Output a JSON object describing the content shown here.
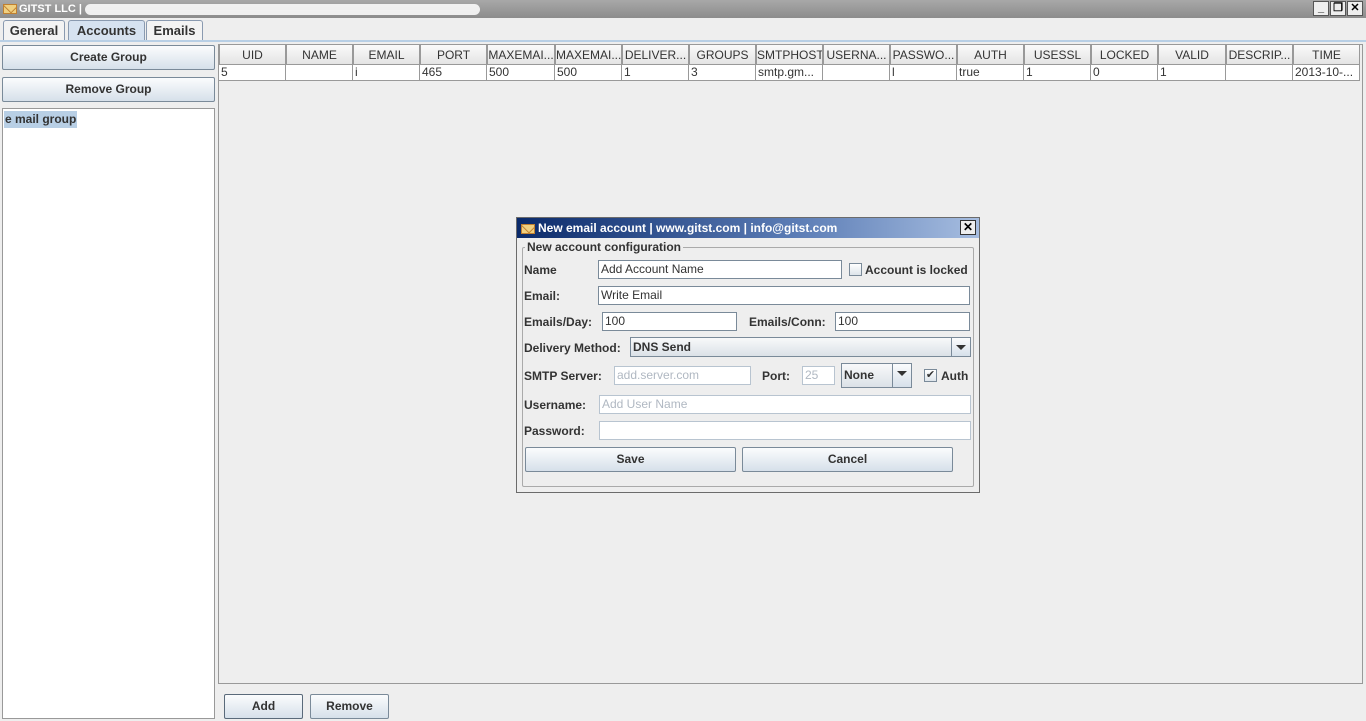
{
  "window": {
    "title": "GITST LLC |",
    "controls": [
      "minimize",
      "restore",
      "close"
    ]
  },
  "tabs": [
    {
      "label": "General"
    },
    {
      "label": "Accounts",
      "selected": true
    },
    {
      "label": "Emails"
    }
  ],
  "sidebar": {
    "create_group": "Create Group",
    "remove_group": "Remove Group",
    "groups": [
      "e mail group"
    ]
  },
  "table": {
    "columns": [
      "UID",
      "NAME",
      "EMAIL",
      "PORT",
      "MAXEMAI...",
      "MAXEMAI...",
      "DELIVER...",
      "GROUPS",
      "SMTPHOST",
      "USERNA...",
      "PASSWO...",
      "AUTH",
      "USESSL",
      "LOCKED",
      "VALID",
      "DESCRIP...",
      "TIME"
    ],
    "rows": [
      [
        "5",
        "",
        "i",
        "465",
        "500",
        "500",
        "1",
        "3",
        "smtp.gm...",
        "",
        "l",
        "true",
        "1",
        "0",
        "1",
        "",
        "2013-10-..."
      ]
    ]
  },
  "bottom": {
    "add": "Add",
    "remove": "Remove"
  },
  "dialog": {
    "title": "New email account | www.gitst.com | info@gitst.com",
    "group_title": "New account configuration",
    "name_label": "Name",
    "name_value": "Add Account Name",
    "locked_label": "Account is locked",
    "locked_checked": false,
    "email_label": "Email:",
    "email_value": "Write Email",
    "per_day_label": "Emails/Day:",
    "per_day_value": "100",
    "per_conn_label": "Emails/Conn:",
    "per_conn_value": "100",
    "delivery_label": "Delivery Method:",
    "delivery_value": "DNS Send",
    "smtp_label": "SMTP Server:",
    "smtp_placeholder": "add.server.com",
    "port_label": "Port:",
    "port_placeholder": "25",
    "security_value": "None",
    "auth_label": "Auth",
    "auth_checked": true,
    "username_label": "Username:",
    "username_placeholder": "Add User Name",
    "password_label": "Password:",
    "password_value": "",
    "save": "Save",
    "cancel": "Cancel"
  }
}
